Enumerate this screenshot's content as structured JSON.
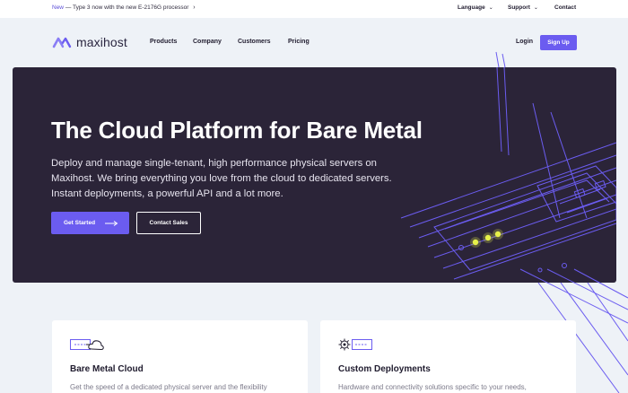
{
  "topbar": {
    "announcement_new": "New",
    "announcement_text": "— Type 3 now with the new E-2176G processor",
    "language": "Language",
    "support": "Support",
    "contact": "Contact"
  },
  "nav": {
    "brand": "maxihost",
    "links": [
      "Products",
      "Company",
      "Customers",
      "Pricing"
    ],
    "login": "Login",
    "signup": "Sign Up"
  },
  "hero": {
    "title": "The Cloud Platform for Bare Metal",
    "subtitle": "Deploy and manage single-tenant, high performance physical servers on Maxihost. We bring everything you love from the cloud to dedicated servers. Instant deployments, a powerful API and a lot more.",
    "primary_cta": "Get Started",
    "secondary_cta": "Contact Sales"
  },
  "features": [
    {
      "title": "Bare Metal Cloud",
      "text": "Get the speed of a dedicated physical server and the flexibility",
      "icon": "cloud-server-icon"
    },
    {
      "title": "Custom Deployments",
      "text": "Hardware and connectivity solutions specific to your needs,",
      "icon": "gear-server-icon"
    }
  ],
  "colors": {
    "accent": "#6b5cf0",
    "hero_bg": "#2b2438",
    "page_bg": "#eef2f7",
    "server_led": "#e6f04a"
  }
}
